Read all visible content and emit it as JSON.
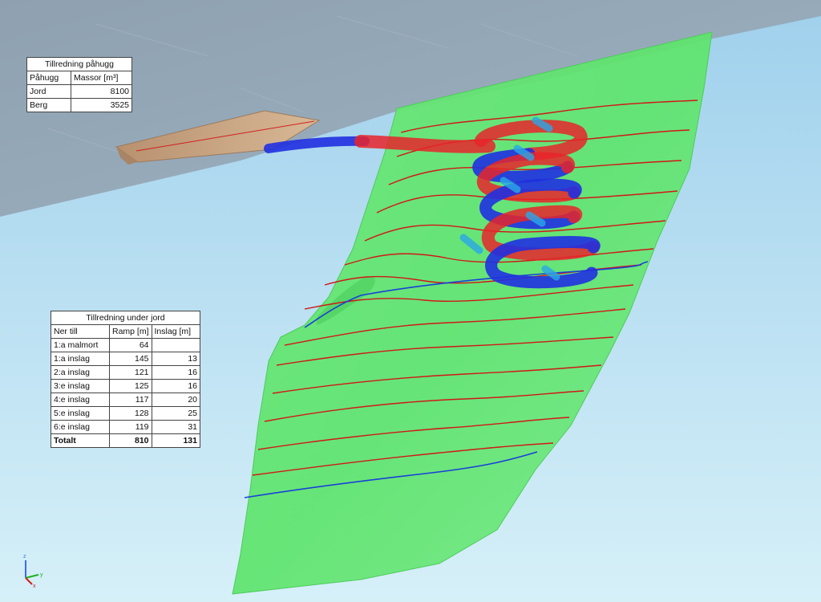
{
  "table_pahugg": {
    "title": "Tillredning påhugg",
    "headers": [
      "Påhugg",
      "Massor [m³]"
    ],
    "rows": [
      {
        "label": "Jord",
        "value": "8100"
      },
      {
        "label": "Berg",
        "value": "3525"
      }
    ]
  },
  "table_under_jord": {
    "title": "Tillredning under jord",
    "headers": [
      "Ner till",
      "Ramp [m]",
      "Inslag [m]"
    ],
    "rows": [
      {
        "label": "1:a malmort",
        "ramp": "64",
        "inslag": ""
      },
      {
        "label": "1:a inslag",
        "ramp": "145",
        "inslag": "13"
      },
      {
        "label": "2:a inslag",
        "ramp": "121",
        "inslag": "16"
      },
      {
        "label": "3:e inslag",
        "ramp": "125",
        "inslag": "16"
      },
      {
        "label": "4:e inslag",
        "ramp": "117",
        "inslag": "20"
      },
      {
        "label": "5:e inslag",
        "ramp": "128",
        "inslag": "25"
      },
      {
        "label": "6:e inslag",
        "ramp": "119",
        "inslag": "31"
      }
    ],
    "total": {
      "label": "Totalt",
      "ramp": "810",
      "inslag": "131"
    }
  },
  "axis_triad": {
    "z": "z",
    "y": "y",
    "x": "x"
  },
  "colors": {
    "sky": "#bfe4f4",
    "ground_surface": "#8ea3b3",
    "ore_body": "#5fe86a",
    "ramp_red": "#e8242a",
    "ramp_blue": "#2030e0",
    "portal_cut": "#c9a27e",
    "level_line_red": "#d01818",
    "level_line_blue": "#1840d8"
  }
}
